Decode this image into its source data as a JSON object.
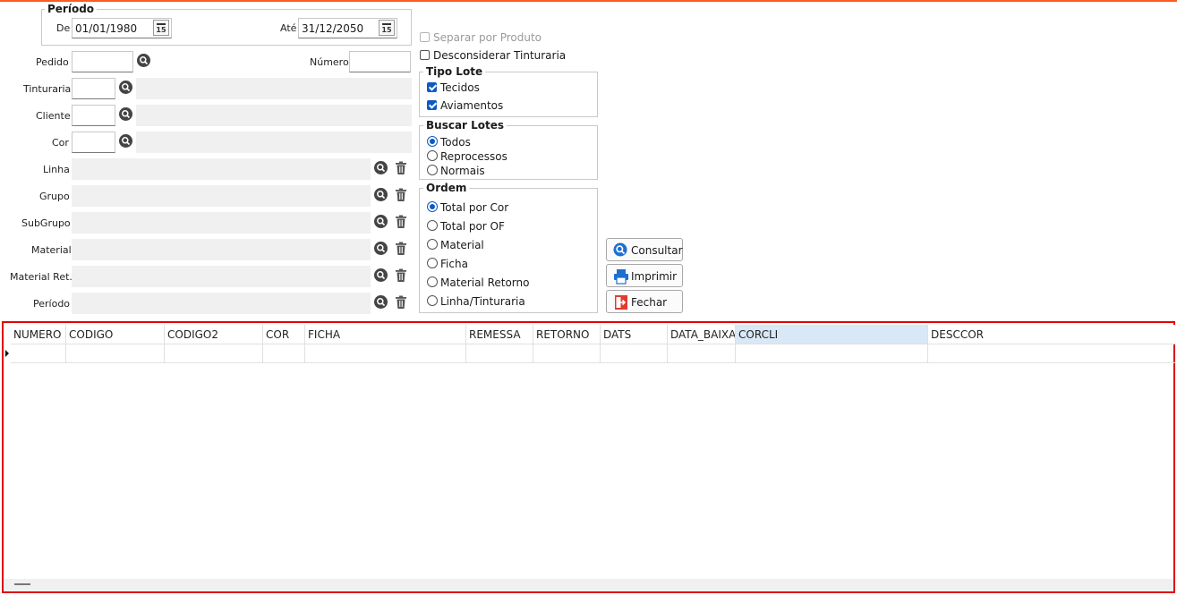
{
  "periodo": {
    "legend": "Período",
    "de_label": "De",
    "de_value": "01/01/1980",
    "ate_label": "Até",
    "ate_value": "31/12/2050",
    "cal_glyph": "15"
  },
  "fields": {
    "pedido": "Pedido",
    "numero": "Número",
    "tinturaria": "Tinturaria",
    "cliente": "Cliente",
    "cor": "Cor",
    "linha": "Linha",
    "grupo": "Grupo",
    "subgrupo": "SubGrupo",
    "material": "Material",
    "material_ret": "Material Ret.",
    "periodo": "Período"
  },
  "options": {
    "separar_por_produto": "Separar por Produto",
    "desconsiderar_tinturaria": "Desconsiderar Tinturaria"
  },
  "tipo_lote": {
    "legend": "Tipo Lote",
    "items": [
      "Tecidos",
      "Aviamentos"
    ]
  },
  "buscar_lotes": {
    "legend": "Buscar Lotes",
    "items": [
      "Todos",
      "Reprocessos",
      "Normais"
    ],
    "selected": "Todos"
  },
  "ordem": {
    "legend": "Ordem",
    "items": [
      "Total por Cor",
      "Total por OF",
      "Material",
      "Ficha",
      "Material Retorno",
      "Linha/Tinturaria"
    ],
    "selected": "Total por Cor"
  },
  "buttons": {
    "consultar": "Consultar",
    "imprimir": "Imprimir",
    "fechar": "Fechar"
  },
  "grid": {
    "columns": [
      "NUMERO",
      "CODIGO",
      "CODIGO2",
      "COR",
      "FICHA",
      "REMESSA",
      "RETORNO",
      "DATS",
      "DATA_BAIXA",
      "CORCLI",
      "DESCCOR"
    ],
    "selected_column": "CORCLI"
  },
  "colors": {
    "accent": "#ff5a1f",
    "grid_border": "#e00000",
    "check_blue": "#0a5bc4",
    "selected_header": "#d9e8f7"
  },
  "icons": [
    "calendar-icon",
    "search-icon",
    "trash-icon",
    "printer-icon",
    "exit-icon"
  ]
}
